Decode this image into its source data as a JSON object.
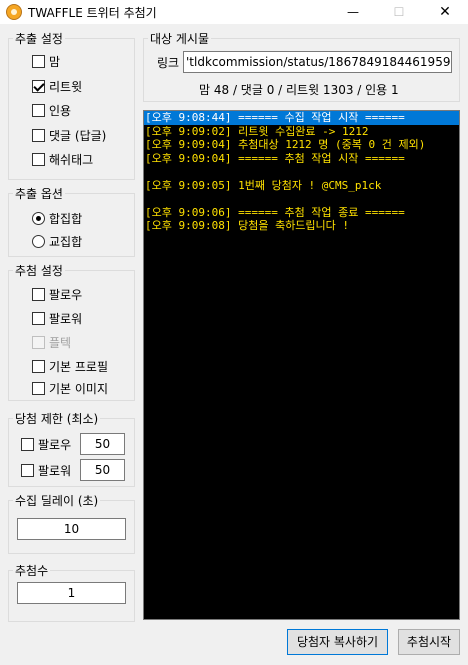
{
  "window": {
    "title": "TWAFFLE 트위터 추첨기",
    "min": "—",
    "max": "☐",
    "close": "✕"
  },
  "extract_settings": {
    "title": "추출 설정",
    "items": [
      {
        "label": "맘",
        "checked": false
      },
      {
        "label": "리트윗",
        "checked": true
      },
      {
        "label": "인용",
        "checked": false
      },
      {
        "label": "댓글 (답글)",
        "checked": false
      },
      {
        "label": "해쉬태그",
        "checked": false
      }
    ]
  },
  "extract_options": {
    "title": "추출 옵션",
    "items": [
      {
        "label": "합집합",
        "selected": true
      },
      {
        "label": "교집합",
        "selected": false
      }
    ]
  },
  "draw_settings": {
    "title": "추첨 설정",
    "items": [
      {
        "label": "팔로우",
        "checked": false
      },
      {
        "label": "팔로워",
        "checked": false
      },
      {
        "label": "플텍",
        "checked": false,
        "disabled": true
      },
      {
        "label": "기본 프로필",
        "checked": false
      },
      {
        "label": "기본 이미지",
        "checked": false
      }
    ]
  },
  "win_limit": {
    "title": "당첨 제한 (최소)",
    "rows": [
      {
        "label": "팔로우",
        "value": "50"
      },
      {
        "label": "팔로워",
        "value": "50"
      }
    ]
  },
  "collect_delay": {
    "title": "수집 딜레이 (초)",
    "value": "10"
  },
  "draw_count": {
    "title": "추첨수",
    "value": "1"
  },
  "target_post": {
    "title": "대상 게시물",
    "link_label": "링크",
    "link_value": "'tldkcommission/status/1867849184461959390",
    "stats": "맘 48 / 댓글 0 / 리트윗 1303 / 인용 1"
  },
  "log": {
    "lines": [
      {
        "text": "[오후 9:08:44] ====== 수집 작업 시작 ======",
        "selected": true
      },
      {
        "text": "[오후 9:09:02] 리트윗 수집완료 -> 1212",
        "selected": false
      },
      {
        "text": "[오후 9:09:04] 추첨대상 1212 명 (중복 0 건 제외)",
        "selected": false
      },
      {
        "text": "[오후 9:09:04] ====== 추첨 작업 시작 ======",
        "selected": false
      },
      {
        "text": "",
        "selected": false
      },
      {
        "text": "[오후 9:09:05] 1번째 당첨자 ! @CMS_p1ck",
        "selected": false
      },
      {
        "text": "",
        "selected": false
      },
      {
        "text": "[오후 9:09:06] ====== 추첨 작업 종료 ======",
        "selected": false
      },
      {
        "text": "[오후 9:09:08] 당첨을 축하드립니다 !",
        "selected": false
      }
    ]
  },
  "buttons": {
    "copy_winner": "당첨자 복사하기",
    "start_draw": "추첨시작"
  }
}
